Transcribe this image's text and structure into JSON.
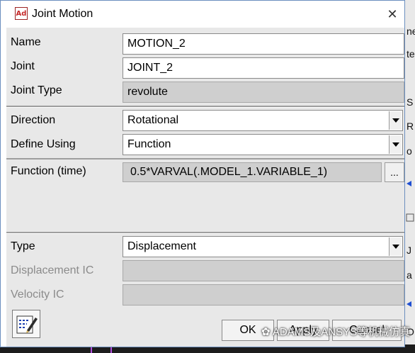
{
  "window": {
    "title": "Joint Motion",
    "app_icon_text": "Ad",
    "close_glyph": "✕"
  },
  "form": {
    "name_label": "Name",
    "name_value": "MOTION_2",
    "joint_label": "Joint",
    "joint_value": "JOINT_2",
    "joint_type_label": "Joint Type",
    "joint_type_value": "revolute",
    "direction_label": "Direction",
    "direction_value": "Rotational",
    "define_using_label": "Define Using",
    "define_using_value": "Function",
    "function_label": "Function (time)",
    "function_value": "0.5*VARVAL(.MODEL_1.VARIABLE_1)",
    "function_button": "...",
    "type_label": "Type",
    "type_value": "Displacement",
    "displacement_ic_label": "Displacement IC",
    "displacement_ic_value": "",
    "velocity_ic_label": "Velocity IC",
    "velocity_ic_value": ""
  },
  "buttons": {
    "ok": "OK",
    "apply": "Apply",
    "cancel": "Cancel"
  },
  "watermark": "ADAMS及ANSYS等机械仿真",
  "background_app": {
    "fragments": [
      "ne",
      "te",
      "S",
      "R",
      "o",
      "J",
      "a",
      "O"
    ]
  },
  "colors": {
    "dialog_body": "#e8e8e8",
    "readonly_field": "#cfcfcf",
    "disabled_label": "#8b8b8b",
    "window_border": "#6b8fbf"
  }
}
